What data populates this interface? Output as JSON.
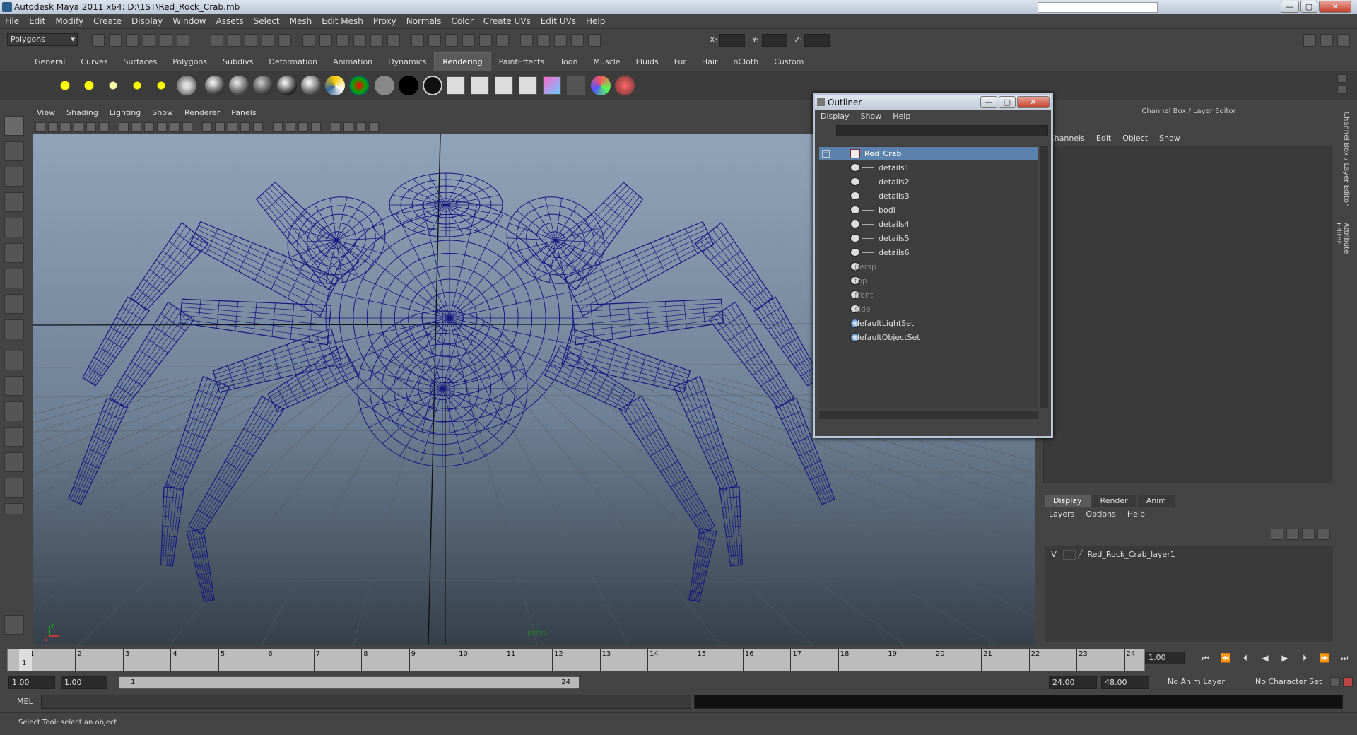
{
  "window": {
    "title": "Autodesk Maya 2011 x64: D:\\1ST\\Red_Rock_Crab.mb"
  },
  "menubar": [
    "File",
    "Edit",
    "Modify",
    "Create",
    "Display",
    "Window",
    "Assets",
    "Select",
    "Mesh",
    "Edit Mesh",
    "Proxy",
    "Normals",
    "Color",
    "Create UVs",
    "Edit UVs",
    "Help"
  ],
  "statusline": {
    "mode": "Polygons",
    "x_label": "X:",
    "y_label": "Y:",
    "z_label": "Z:"
  },
  "shelf_tabs": [
    "General",
    "Curves",
    "Surfaces",
    "Polygons",
    "Subdivs",
    "Deformation",
    "Animation",
    "Dynamics",
    "Rendering",
    "PaintEffects",
    "Toon",
    "Muscle",
    "Fluids",
    "Fur",
    "Hair",
    "nCloth",
    "Custom"
  ],
  "shelf_active": "Rendering",
  "viewport": {
    "menu": [
      "View",
      "Shading",
      "Lighting",
      "Show",
      "Renderer",
      "Panels"
    ],
    "camera_label": "persp",
    "wire_color": "#151880"
  },
  "outliner": {
    "title": "Outliner",
    "menu": [
      "Display",
      "Show",
      "Help"
    ],
    "items": [
      {
        "label": "Red_Crab",
        "state": "selected"
      },
      {
        "label": "details1",
        "state": "child"
      },
      {
        "label": "details2",
        "state": "child"
      },
      {
        "label": "details3",
        "state": "child"
      },
      {
        "label": "bodi",
        "state": "child"
      },
      {
        "label": "details4",
        "state": "child"
      },
      {
        "label": "details5",
        "state": "child"
      },
      {
        "label": "details6",
        "state": "child"
      },
      {
        "label": "persp",
        "state": "dim"
      },
      {
        "label": "top",
        "state": "dim"
      },
      {
        "label": "front",
        "state": "dim"
      },
      {
        "label": "side",
        "state": "dim"
      },
      {
        "label": "defaultLightSet",
        "state": "set"
      },
      {
        "label": "defaultObjectSet",
        "state": "set"
      }
    ]
  },
  "channel_box": {
    "title": "Channel Box / Layer Editor",
    "menu": [
      "Channels",
      "Edit",
      "Object",
      "Show"
    ]
  },
  "side_tabs": [
    "Channel Box / Layer Editor",
    "Attribute Editor"
  ],
  "layer_editor": {
    "tabs": [
      "Display",
      "Render",
      "Anim"
    ],
    "active_tab": "Display",
    "menu": [
      "Layers",
      "Options",
      "Help"
    ],
    "layer": {
      "visible": "V",
      "name": "Red_Rock_Crab_layer1"
    }
  },
  "timeline": {
    "ticks": [
      1,
      2,
      3,
      4,
      5,
      6,
      7,
      8,
      9,
      10,
      11,
      12,
      13,
      14,
      15,
      16,
      17,
      18,
      19,
      20,
      21,
      22,
      23,
      24
    ],
    "current_frame": "1",
    "current_frame_field": "1.00"
  },
  "range": {
    "start": "1.00",
    "anim_start": "1.00",
    "slider_start": "1",
    "slider_end": "24",
    "end": "24.00",
    "anim_end": "48.00",
    "anim_layer": "No Anim Layer",
    "char_set": "No Character Set"
  },
  "command": {
    "label": "MEL"
  },
  "help_line": "Select Tool: select an object"
}
